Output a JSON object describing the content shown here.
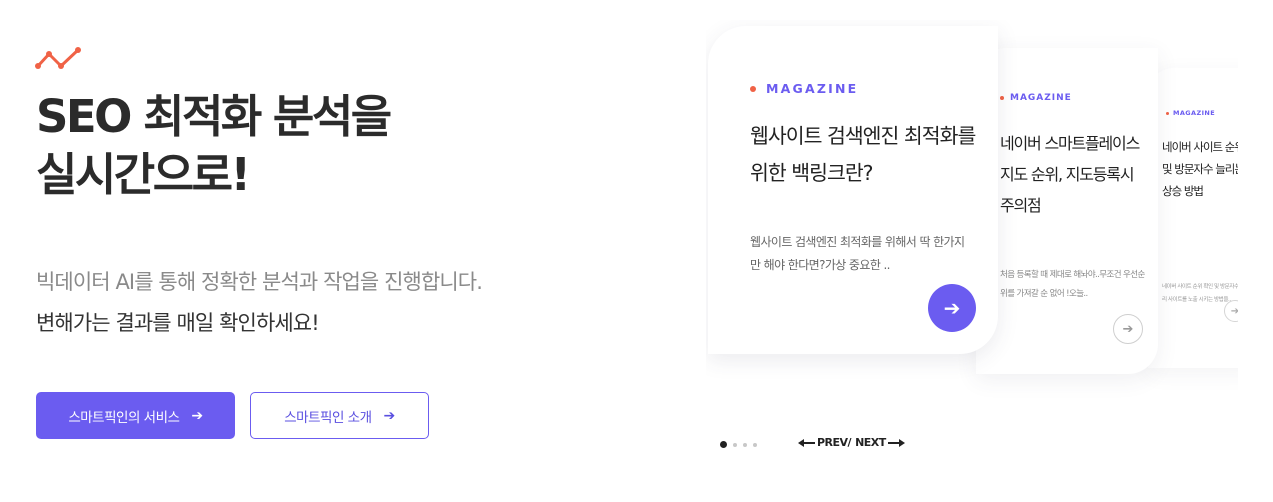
{
  "logo": {
    "icon": "trend-line-icon",
    "color": "#f06246"
  },
  "hero": {
    "title_line1": "SEO 최적화 분석을",
    "title_line2": "실시간으로!",
    "desc_line1": "빅데이터 AI를 통해 정확한 분석과 작업을 진행합니다.",
    "desc_line2": "변해가는 결과를 매일 확인하세요!"
  },
  "buttons": {
    "primary_label": "스마트픽인의 서비스",
    "secondary_label": "스마트픽인 소개",
    "arrow": "➔"
  },
  "cards": [
    {
      "category": "MAGAZINE",
      "title": "웹사이트 검색엔진 최적화를 위한 백링크란?",
      "excerpt": "웹사이트 검색엔진 최적화를 위해서 딱 한가지만 해야 한다면?가상 중요한 ..",
      "arrow": "➔"
    },
    {
      "category": "MAGAZINE",
      "title": "네이버 스마트플레이스 지도 순위, 지도등록시 주의점",
      "excerpt": "처음 등록할 때 제대로 해놔야..무조건 우선순위를 가져갈 순 없어 !오늘..",
      "arrow": "➔"
    },
    {
      "category": "MAGAZINE",
      "title": "네이버 사이트 순위 확인 및 방문자수 늘리는 순위상승 방법",
      "excerpt": "네이버 사이트 순위 확인 및 방문자수 늘리기 위해 우리 사이트를 노출 시키는 방법을..",
      "arrow": "➔"
    }
  ],
  "pagination": {
    "total": 4,
    "active": 1
  },
  "nav": {
    "prev": "PREV/",
    "next": "NEXT"
  },
  "colors": {
    "accent": "#6b5cf0",
    "category_dot": "#f06246"
  }
}
